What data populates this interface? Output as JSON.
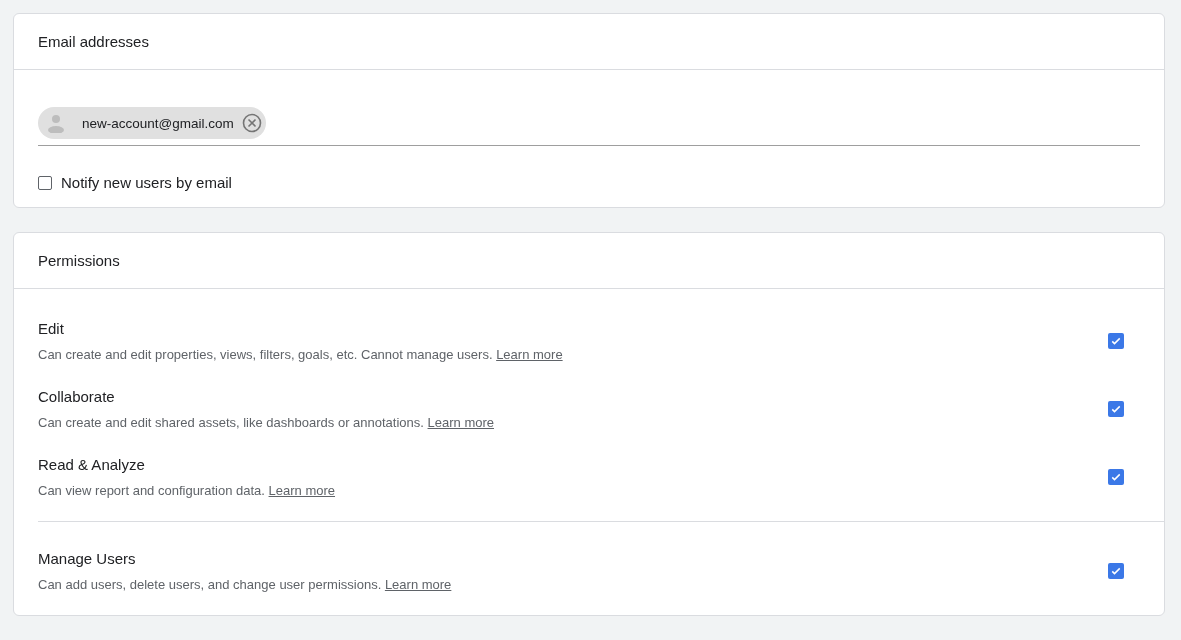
{
  "email_card": {
    "title": "Email addresses",
    "chips": [
      {
        "label": "new-account@gmail.com"
      }
    ],
    "notify": {
      "label": "Notify new users by email",
      "checked": false
    }
  },
  "permissions_card": {
    "title": "Permissions",
    "groups": [
      [
        {
          "name": "Edit",
          "description": "Can create and edit properties, views, filters, goals, etc. Cannot manage users.",
          "link": "Learn more",
          "checked": true
        },
        {
          "name": "Collaborate",
          "description": "Can create and edit shared assets, like dashboards or annotations.",
          "link": "Learn more",
          "checked": true
        },
        {
          "name": "Read & Analyze",
          "description": "Can view report and configuration data.",
          "link": "Learn more",
          "checked": true
        }
      ],
      [
        {
          "name": "Manage Users",
          "description": "Can add users, delete users, and change user permissions.",
          "link": "Learn more",
          "checked": true
        }
      ]
    ]
  }
}
